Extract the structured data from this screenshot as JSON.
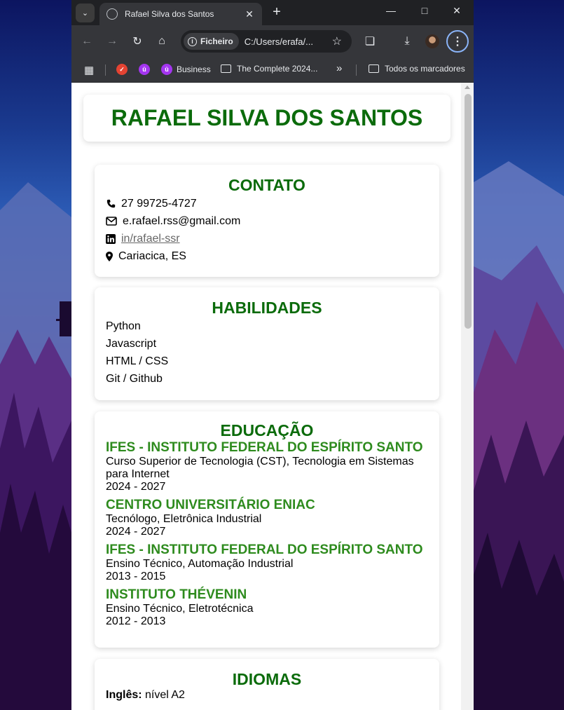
{
  "browser": {
    "tab_title": "Rafael Silva dos Santos",
    "address_chip": "Ficheiro",
    "url": "C:/Users/erafa/...",
    "bookmarks": [
      {
        "label": "Business",
        "type": "site"
      },
      {
        "label": "The Complete 2024...",
        "type": "folder"
      },
      {
        "label": "Todos os marcadores",
        "type": "folder"
      }
    ],
    "overflow_label": "»"
  },
  "resume": {
    "name": "RAFAEL SILVA DOS SANTOS",
    "contact": {
      "title": "CONTATO",
      "phone": "27 99725-4727",
      "email": "e.rafael.rss@gmail.com",
      "linkedin": "in/rafael-ssr",
      "location": "Cariacica, ES"
    },
    "skills": {
      "title": "HABILIDADES",
      "items": [
        "Python",
        "Javascript",
        "HTML / CSS",
        "Git / Github"
      ]
    },
    "education": {
      "title": "EDUCAÇÃO",
      "entries": [
        {
          "institution": "IFES - INSTITUTO FEDERAL DO ESPÍRITO SANTO",
          "course": "Curso Superior de Tecnologia (CST), Tecnologia em Sistemas para Internet",
          "period": "2024 - 2027"
        },
        {
          "institution": "CENTRO UNIVERSITÁRIO ENIAC",
          "course": "Tecnólogo, Eletrônica Industrial",
          "period": "2024 - 2027"
        },
        {
          "institution": "IFES - INSTITUTO FEDERAL DO ESPÍRITO SANTO",
          "course": "Ensino Técnico, Automação Industrial",
          "period": "2013 - 2015"
        },
        {
          "institution": "INSTITUTO THÉVENIN",
          "course": "Ensino Técnico, Eletrotécnica",
          "period": "2012 - 2013"
        }
      ]
    },
    "languages": {
      "title": "IDIOMAS",
      "items": [
        {
          "name": "Inglês:",
          "level": "nível A2"
        }
      ]
    }
  },
  "colors": {
    "heading_green": "#0b6b0b",
    "institution_green": "#2e8b1e",
    "chrome_dark": "#35363a",
    "focus_ring": "#8ab4f8"
  }
}
